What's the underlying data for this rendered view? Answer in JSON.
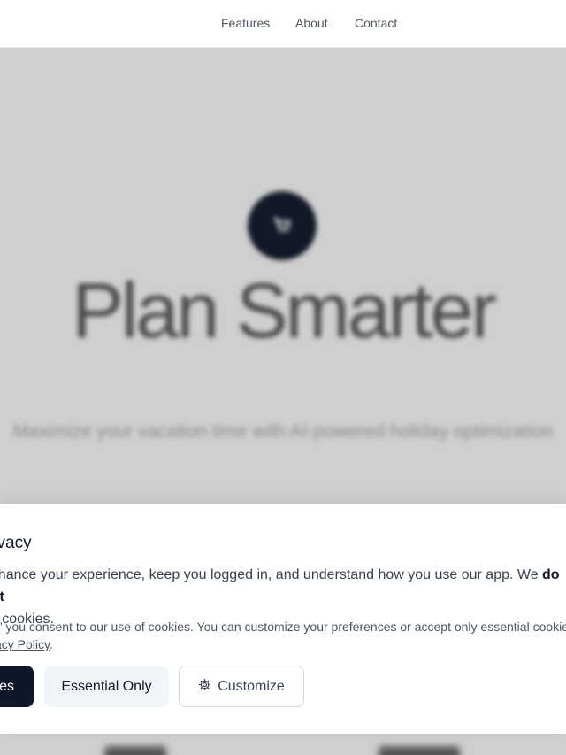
{
  "nav": {
    "features": "Features",
    "about": "About",
    "contact": "Contact"
  },
  "hero": {
    "title": "Plan Smarter",
    "subtitle": "Maximize your vacation time with AI-powered holiday optimization"
  },
  "cookie_banner": {
    "title": "rivacy",
    "body_prefix": "enhance your experience, keep you logged in, and understand how you use our app. We ",
    "body_strong": "do not",
    "body_suffix": "ng cookies.",
    "note_text": ",” you consent to our use of cookies. You can customize your preferences or accept only essential cookies",
    "note_link": "acy Policy",
    "note_end": ".",
    "buttons": {
      "accept": "es",
      "essential": "Essential Only",
      "customize": "Customize"
    }
  },
  "icons": {
    "hero_logo": "cart-icon",
    "customize": "gear-icon"
  },
  "colors": {
    "primary": "#0f172a",
    "hero_bg": "#cfcfcf",
    "secondary_btn": "#f1f5f9"
  }
}
